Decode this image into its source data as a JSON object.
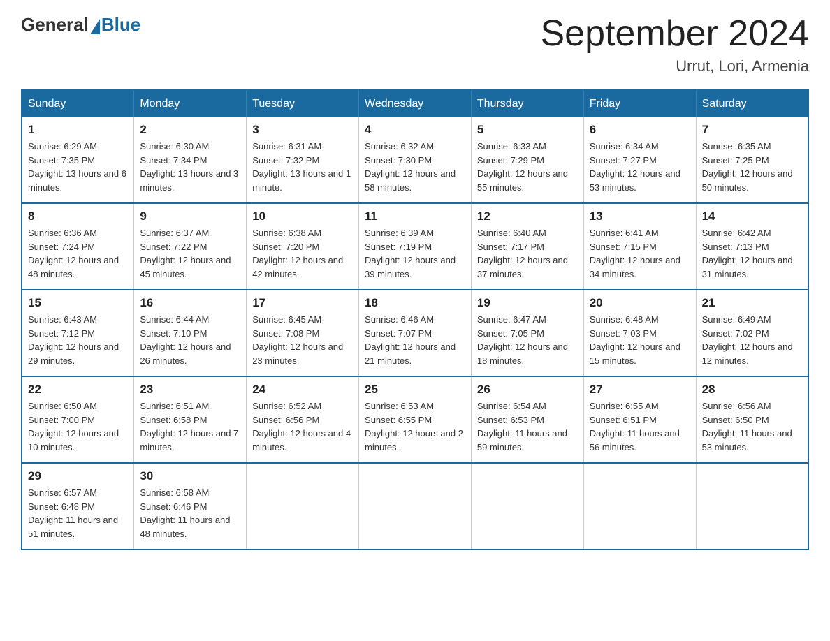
{
  "header": {
    "logo_general": "General",
    "logo_blue": "Blue",
    "title": "September 2024",
    "location": "Urrut, Lori, Armenia"
  },
  "weekdays": [
    "Sunday",
    "Monday",
    "Tuesday",
    "Wednesday",
    "Thursday",
    "Friday",
    "Saturday"
  ],
  "weeks": [
    [
      {
        "day": "1",
        "sunrise": "6:29 AM",
        "sunset": "7:35 PM",
        "daylight": "13 hours and 6 minutes."
      },
      {
        "day": "2",
        "sunrise": "6:30 AM",
        "sunset": "7:34 PM",
        "daylight": "13 hours and 3 minutes."
      },
      {
        "day": "3",
        "sunrise": "6:31 AM",
        "sunset": "7:32 PM",
        "daylight": "13 hours and 1 minute."
      },
      {
        "day": "4",
        "sunrise": "6:32 AM",
        "sunset": "7:30 PM",
        "daylight": "12 hours and 58 minutes."
      },
      {
        "day": "5",
        "sunrise": "6:33 AM",
        "sunset": "7:29 PM",
        "daylight": "12 hours and 55 minutes."
      },
      {
        "day": "6",
        "sunrise": "6:34 AM",
        "sunset": "7:27 PM",
        "daylight": "12 hours and 53 minutes."
      },
      {
        "day": "7",
        "sunrise": "6:35 AM",
        "sunset": "7:25 PM",
        "daylight": "12 hours and 50 minutes."
      }
    ],
    [
      {
        "day": "8",
        "sunrise": "6:36 AM",
        "sunset": "7:24 PM",
        "daylight": "12 hours and 48 minutes."
      },
      {
        "day": "9",
        "sunrise": "6:37 AM",
        "sunset": "7:22 PM",
        "daylight": "12 hours and 45 minutes."
      },
      {
        "day": "10",
        "sunrise": "6:38 AM",
        "sunset": "7:20 PM",
        "daylight": "12 hours and 42 minutes."
      },
      {
        "day": "11",
        "sunrise": "6:39 AM",
        "sunset": "7:19 PM",
        "daylight": "12 hours and 39 minutes."
      },
      {
        "day": "12",
        "sunrise": "6:40 AM",
        "sunset": "7:17 PM",
        "daylight": "12 hours and 37 minutes."
      },
      {
        "day": "13",
        "sunrise": "6:41 AM",
        "sunset": "7:15 PM",
        "daylight": "12 hours and 34 minutes."
      },
      {
        "day": "14",
        "sunrise": "6:42 AM",
        "sunset": "7:13 PM",
        "daylight": "12 hours and 31 minutes."
      }
    ],
    [
      {
        "day": "15",
        "sunrise": "6:43 AM",
        "sunset": "7:12 PM",
        "daylight": "12 hours and 29 minutes."
      },
      {
        "day": "16",
        "sunrise": "6:44 AM",
        "sunset": "7:10 PM",
        "daylight": "12 hours and 26 minutes."
      },
      {
        "day": "17",
        "sunrise": "6:45 AM",
        "sunset": "7:08 PM",
        "daylight": "12 hours and 23 minutes."
      },
      {
        "day": "18",
        "sunrise": "6:46 AM",
        "sunset": "7:07 PM",
        "daylight": "12 hours and 21 minutes."
      },
      {
        "day": "19",
        "sunrise": "6:47 AM",
        "sunset": "7:05 PM",
        "daylight": "12 hours and 18 minutes."
      },
      {
        "day": "20",
        "sunrise": "6:48 AM",
        "sunset": "7:03 PM",
        "daylight": "12 hours and 15 minutes."
      },
      {
        "day": "21",
        "sunrise": "6:49 AM",
        "sunset": "7:02 PM",
        "daylight": "12 hours and 12 minutes."
      }
    ],
    [
      {
        "day": "22",
        "sunrise": "6:50 AM",
        "sunset": "7:00 PM",
        "daylight": "12 hours and 10 minutes."
      },
      {
        "day": "23",
        "sunrise": "6:51 AM",
        "sunset": "6:58 PM",
        "daylight": "12 hours and 7 minutes."
      },
      {
        "day": "24",
        "sunrise": "6:52 AM",
        "sunset": "6:56 PM",
        "daylight": "12 hours and 4 minutes."
      },
      {
        "day": "25",
        "sunrise": "6:53 AM",
        "sunset": "6:55 PM",
        "daylight": "12 hours and 2 minutes."
      },
      {
        "day": "26",
        "sunrise": "6:54 AM",
        "sunset": "6:53 PM",
        "daylight": "11 hours and 59 minutes."
      },
      {
        "day": "27",
        "sunrise": "6:55 AM",
        "sunset": "6:51 PM",
        "daylight": "11 hours and 56 minutes."
      },
      {
        "day": "28",
        "sunrise": "6:56 AM",
        "sunset": "6:50 PM",
        "daylight": "11 hours and 53 minutes."
      }
    ],
    [
      {
        "day": "29",
        "sunrise": "6:57 AM",
        "sunset": "6:48 PM",
        "daylight": "11 hours and 51 minutes."
      },
      {
        "day": "30",
        "sunrise": "6:58 AM",
        "sunset": "6:46 PM",
        "daylight": "11 hours and 48 minutes."
      },
      null,
      null,
      null,
      null,
      null
    ]
  ]
}
